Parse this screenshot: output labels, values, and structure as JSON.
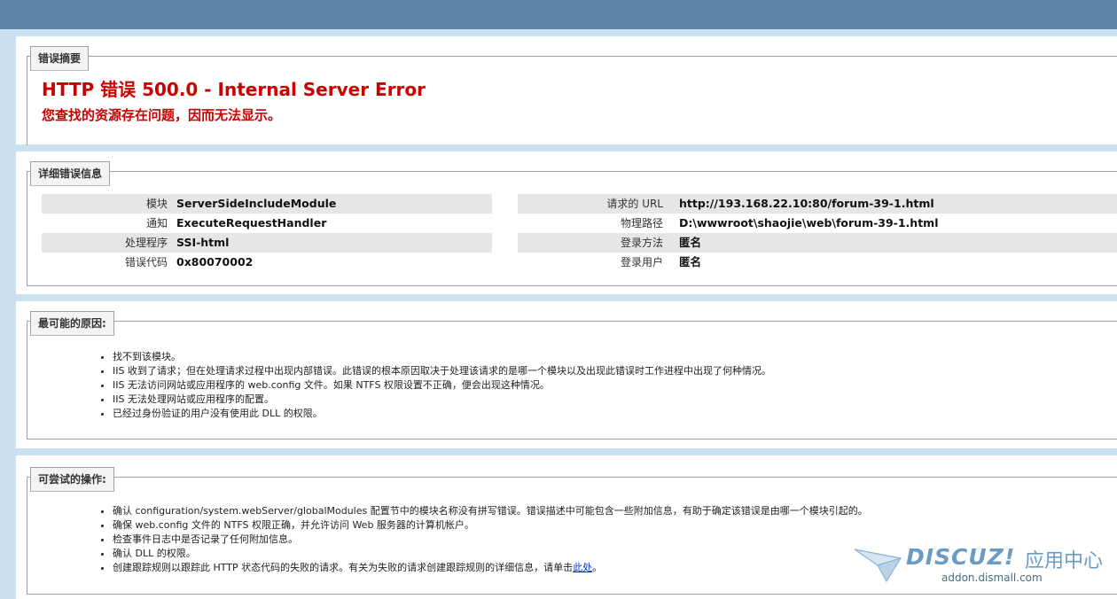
{
  "summary": {
    "legend": "错误摘要",
    "title": "HTTP 错误 500.0 - Internal Server Error",
    "subtitle": "您查找的资源存在问题，因而无法显示。"
  },
  "details": {
    "legend": "详细错误信息",
    "left": [
      {
        "label": "模块",
        "value": "ServerSideIncludeModule"
      },
      {
        "label": "通知",
        "value": "ExecuteRequestHandler"
      },
      {
        "label": "处理程序",
        "value": "SSI-html"
      },
      {
        "label": "错误代码",
        "value": "0x80070002"
      }
    ],
    "right": [
      {
        "label": "请求的 URL",
        "value": "http://193.168.22.10:80/forum-39-1.html"
      },
      {
        "label": "物理路径",
        "value": "D:\\wwwroot\\shaojie\\web\\forum-39-1.html"
      },
      {
        "label": "登录方法",
        "value": "匿名"
      },
      {
        "label": "登录用户",
        "value": "匿名"
      }
    ]
  },
  "causes": {
    "legend": "最可能的原因:",
    "items": [
      "找不到该模块。",
      "IIS 收到了请求；但在处理请求过程中出现内部错误。此错误的根本原因取决于处理该请求的是哪一个模块以及出现此错误时工作进程中出现了何种情况。",
      "IIS 无法访问网站或应用程序的 web.config 文件。如果 NTFS 权限设置不正确，便会出现这种情况。",
      "IIS 无法处理网站或应用程序的配置。",
      "已经过身份验证的用户没有使用此 DLL 的权限。"
    ]
  },
  "actions": {
    "legend": "可尝试的操作:",
    "items": [
      "确认 configuration/system.webServer/globalModules 配置节中的模块名称没有拼写错误。错误描述中可能包含一些附加信息，有助于确定该错误是由哪一个模块引起的。",
      "确保 web.config 文件的 NTFS 权限正确，并允许访问 Web 服务器的计算机帐户。",
      "检查事件日志中是否记录了任何附加信息。",
      "确认 DLL 的权限。"
    ],
    "last_item_text": "创建跟踪规则以跟踪此 HTTP 状态代码的失败的请求。有关为失败的请求创建跟踪规则的详细信息，请单击",
    "link_text": "此处",
    "last_item_suffix": "。"
  },
  "watermark": {
    "brand": "DISCUZ!",
    "suffix": "应用中心",
    "url": "addon.dismall.com"
  },
  "colors": {
    "header_bar": "#5c83a6",
    "background": "#cbe1ef",
    "error_red": "#cc0000",
    "row_shade": "#e6e6e6",
    "watermark_blue": "#6b9bc3"
  }
}
